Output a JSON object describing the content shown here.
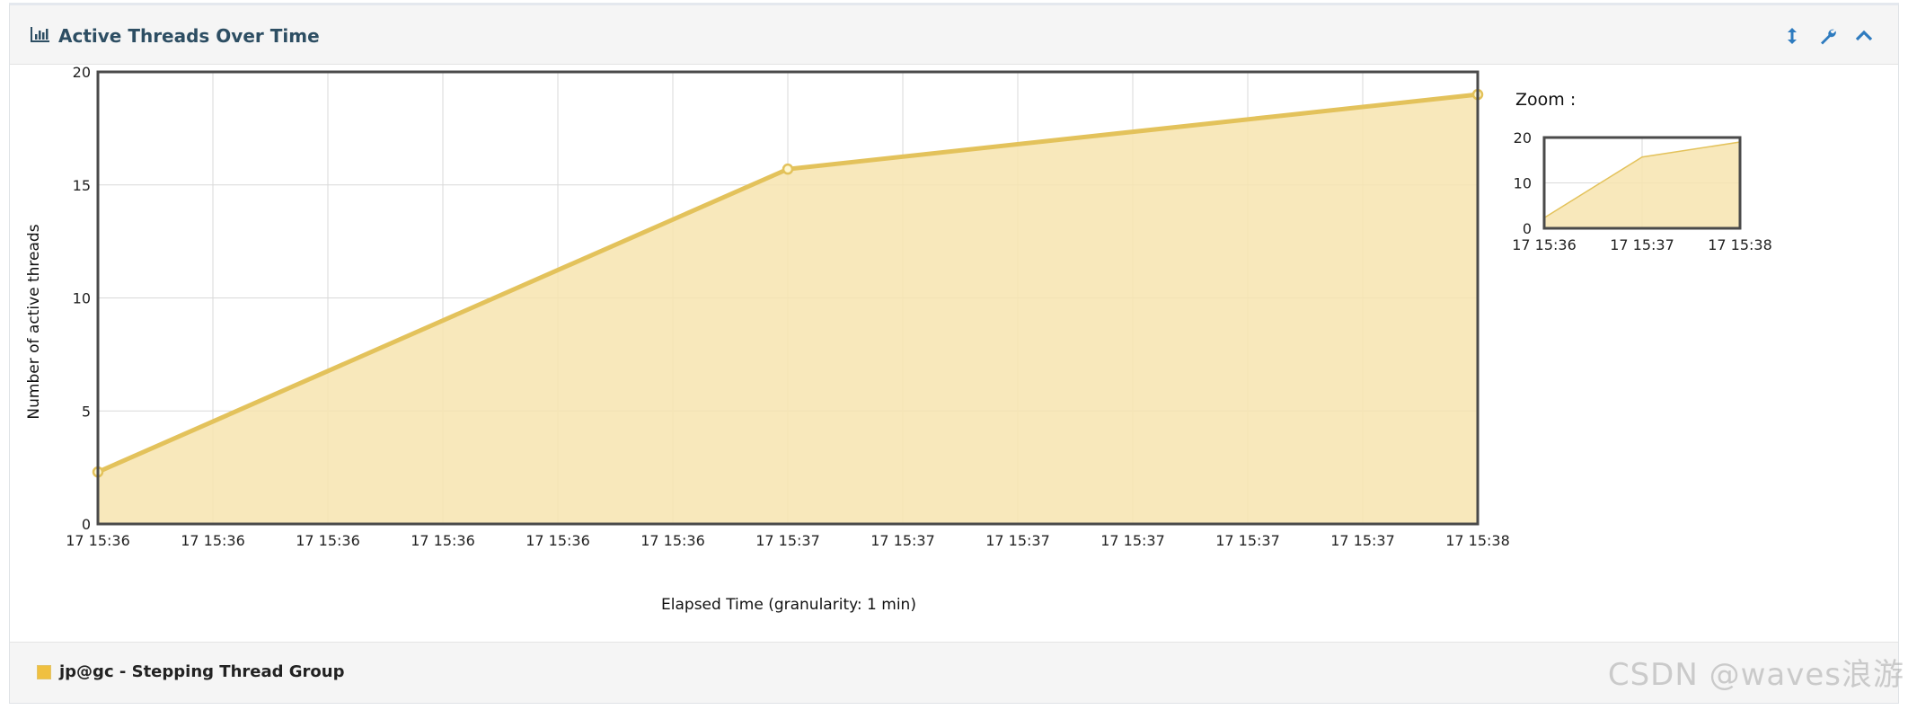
{
  "panel": {
    "title": "Active Threads Over Time",
    "icons": {
      "title_icon": "bar-chart-icon",
      "tools": [
        "resize-vertical-icon",
        "wrench-icon",
        "chevron-up-icon"
      ]
    }
  },
  "zoom": {
    "label": "Zoom :"
  },
  "legend": {
    "items": [
      {
        "label": "jp@gc - Stepping Thread Group",
        "color": "#f0c040"
      }
    ]
  },
  "watermark": "CSDN @waves浪游",
  "colors": {
    "area_fill": "#f7e4af",
    "line": "#e3c25b",
    "marker_fill": "#fff7cf"
  },
  "chart_data": {
    "type": "area",
    "title": "",
    "ylabel": "Number of active threads",
    "xlabel": "Elapsed Time (granularity: 1 min)",
    "ylim": [
      0,
      20
    ],
    "yticks": [
      0,
      5,
      10,
      15,
      20
    ],
    "xtick_labels": [
      "17 15:36",
      "17 15:36",
      "17 15:36",
      "17 15:36",
      "17 15:36",
      "17 15:36",
      "17 15:37",
      "17 15:37",
      "17 15:37",
      "17 15:37",
      "17 15:37",
      "17 15:37",
      "17 15:38"
    ],
    "x_range": [
      "15:36",
      "15:38"
    ],
    "grid": true,
    "series": [
      {
        "name": "jp@gc - Stepping Thread Group",
        "x": [
          "15:36",
          "15:37",
          "15:38"
        ],
        "values": [
          2.3,
          15.7,
          19
        ]
      }
    ],
    "overview": {
      "yticks": [
        0,
        10,
        20
      ],
      "xtick_labels": [
        "17 15:36",
        "17 15:37",
        "17 15:38"
      ]
    }
  }
}
